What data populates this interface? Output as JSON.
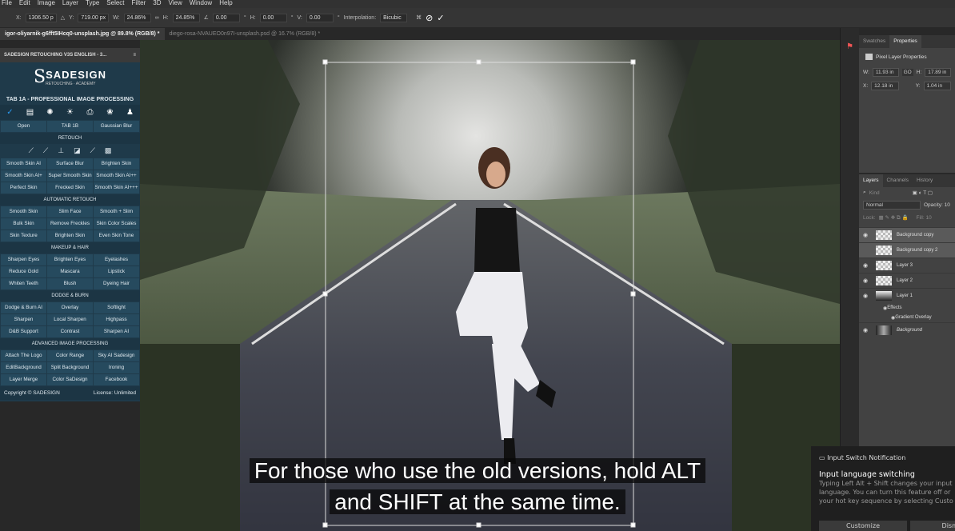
{
  "menu": [
    "File",
    "Edit",
    "Image",
    "Layer",
    "Type",
    "Select",
    "Filter",
    "3D",
    "View",
    "Window",
    "Help"
  ],
  "options": {
    "x_label": "X:",
    "x": "1306.50 p",
    "y_label": "Y:",
    "y": "719.00 px",
    "w_label": "W:",
    "w": "24.86%",
    "h_label": "H:",
    "h": "24.85%",
    "angle": "0.00",
    "hskew_label": "H:",
    "hskew": "0.00",
    "vskew_label": "V:",
    "vskew": "0.00",
    "interp_label": "Interpolation:",
    "interp": "Bicubic"
  },
  "tabs": [
    {
      "label": "igor-oliyarnik-g6fft5IHcq0-unsplash.jpg @ 89.8% (RGB/8) *"
    },
    {
      "label": "diego-rosa-NVAUEO0n97I-unsplash.psd @ 16.7% (RGB/8) *"
    }
  ],
  "plugin": {
    "title": "SADESIGN RETOUCHING V3S ENGLISH - 3...",
    "logo": "SADESIGN",
    "logo_sub": "RETOUCHING · ACADEMY",
    "tab_title": "TAB 1A - PROFESSIONAL IMAGE PROCESSING",
    "top": [
      "Open",
      "TAB 1B",
      "Gaussian Blur"
    ],
    "sections": [
      {
        "title": "RETOUCH",
        "buttons": [
          "Smooth Skin AI",
          "Surface Blur",
          "Brighten Skin",
          "Smooth Skin AI+",
          "Super Smooth Skin",
          "Smooth Skin AI++",
          "Perfect Skin",
          "Frecked Skin",
          "Smooth Skin AI+++"
        ]
      },
      {
        "title": "AUTOMATIC RETOUCH",
        "buttons": [
          "Smooth Skin",
          "Slim Face",
          "Smooth + Slim",
          "Bulk Skin",
          "Remove Freckles",
          "Skin Color Scales",
          "Skin Texture",
          "Brighten Skin",
          "Even Skin Tone"
        ]
      },
      {
        "title": "MAKEUP & HAIR",
        "buttons": [
          "Sharpen Eyes",
          "Brighten Eyes",
          "Eyelashes",
          "Reduce Gold",
          "Mascara",
          "Lipstick",
          "Whiten Teeth",
          "Blush",
          "Dyeing Hair"
        ]
      },
      {
        "title": "DODGE & BURN",
        "buttons": [
          "Dodge & Burn AI",
          "Overlay",
          "Softlight",
          "Sharpen",
          "Local Sharpen",
          "Highpass",
          "D&B Support",
          "Contrast",
          "Sharpen AI"
        ]
      },
      {
        "title": "ADVANCED IMAGE PROCESSING",
        "buttons": [
          "Attach The Logo",
          "Color Range",
          "Sky AI Sadesign",
          "EditBackground",
          "Split Background",
          "Ironing",
          "Layer Merge",
          "Color SaDesign",
          "Facebook"
        ]
      }
    ],
    "copyright": "Copyright © SADESIGN",
    "license": "License: Unlimited"
  },
  "properties": {
    "tabs": [
      "Swatches",
      "Properties"
    ],
    "title": "Pixel Layer Properties",
    "w": "11.93 in",
    "h": "17.89 in",
    "x": "12.18 in",
    "y": "1.04 in"
  },
  "layers": {
    "tabs": [
      "Layers",
      "Channels",
      "History"
    ],
    "kind": "Kind",
    "blend": "Normal",
    "opacity_label": "Opacity: 10",
    "lock_label": "Lock:",
    "fill_label": "Fill: 10",
    "items": [
      "Background copy",
      "Background copy 2",
      "Layer 3",
      "Layer 2",
      "Layer 1"
    ],
    "effects": "Effects",
    "gradient": "Gradient Overlay",
    "background": "Background"
  },
  "subtitle": {
    "line1": "For those who use the old versions, hold ALT",
    "line2": "and SHIFT at the same time."
  },
  "notification": {
    "app": "Input Switch Notification",
    "title": "Input language switching",
    "body1": "Typing Left Alt + Shift changes your input",
    "body2": "language. You can turn this feature off or",
    "body3": "your hot key sequence by selecting Custo",
    "customize": "Customize",
    "dismiss": "Dismiss"
  }
}
